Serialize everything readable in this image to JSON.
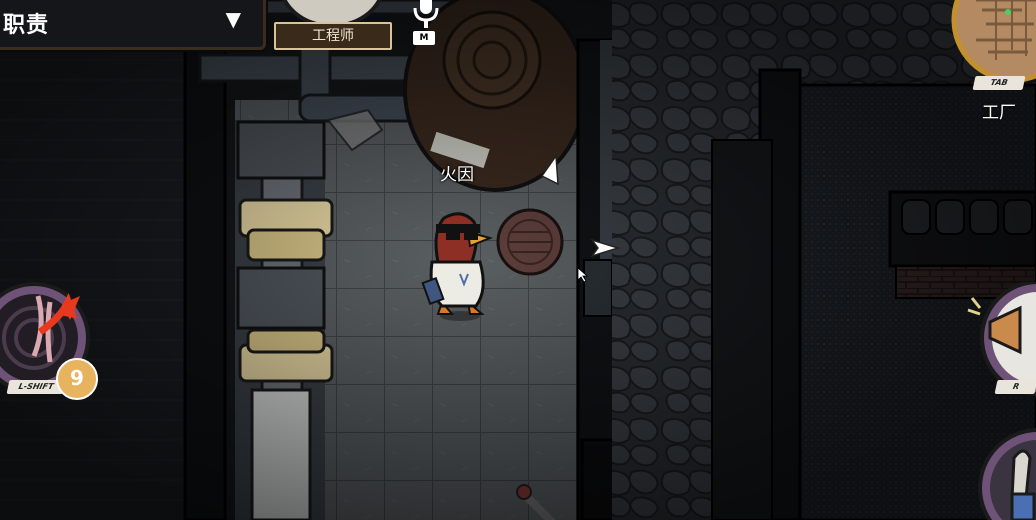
{
  "hud": {
    "task_panel": {
      "title": "职责",
      "toggle_icon": "triangle-down-icon"
    },
    "role": {
      "label": "工程师"
    },
    "voice": {
      "key": "M",
      "icon": "microphone-icon"
    },
    "player": {
      "name": "火因"
    },
    "minimap": {
      "key": "TAB",
      "location": "工厂"
    },
    "abilities": {
      "left": {
        "key": "L-SHIFT",
        "cooldown": "9",
        "icon": "vent-icon"
      },
      "right_top": {
        "key": "R",
        "icon": "report-horn-icon"
      },
      "right_bottom": {
        "icon": "use-hand-icon"
      }
    }
  },
  "colors": {
    "floor": "#555a5d",
    "wall_dark": "#101215",
    "pipe": "#3e4853",
    "accent_orange": "#e7b35f",
    "ability_purple": "#6e5277",
    "duck_red": "#8d2f25"
  }
}
